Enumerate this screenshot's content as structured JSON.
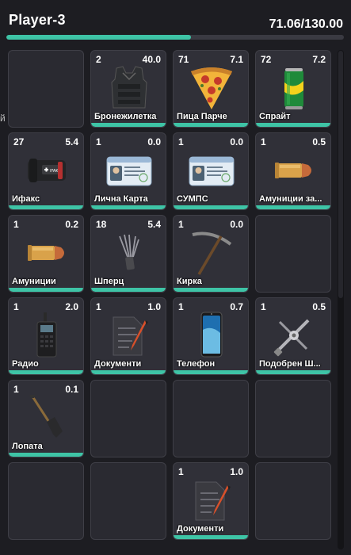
{
  "header": {
    "player_name": "Player-3",
    "weight_text": "71.06/130.00",
    "weight_fraction": 0.5466
  },
  "side_text": "й",
  "colors": {
    "accent": "#3ec4a6",
    "slot_bg": "#2a2a31",
    "slot_border": "#3f3f47",
    "page_bg": "#1d1d22"
  },
  "slots": [
    {
      "empty": true
    },
    {
      "qty": "2",
      "weight": "40.0",
      "name": "Бронежилетка",
      "icon": "armor-vest-icon"
    },
    {
      "qty": "71",
      "weight": "7.1",
      "name": "Пица Парче",
      "icon": "pizza-slice-icon"
    },
    {
      "qty": "72",
      "weight": "7.2",
      "name": "Спрайт",
      "icon": "soda-can-icon"
    },
    {
      "qty": "27",
      "weight": "5.4",
      "name": "Ифакс",
      "icon": "ifak-kit-icon"
    },
    {
      "qty": "1",
      "weight": "0.0",
      "name": "Лична Карта",
      "icon": "id-card-icon"
    },
    {
      "qty": "1",
      "weight": "0.0",
      "name": "СУМПС",
      "icon": "id-card-icon"
    },
    {
      "qty": "1",
      "weight": "0.5",
      "name": "Амуниции за...",
      "icon": "ammo-icon"
    },
    {
      "qty": "1",
      "weight": "0.2",
      "name": "Амуниции",
      "icon": "ammo-icon"
    },
    {
      "qty": "18",
      "weight": "5.4",
      "name": "Шперц",
      "icon": "lockpick-icon"
    },
    {
      "qty": "1",
      "weight": "0.0",
      "name": "Кирка",
      "icon": "pickaxe-icon"
    },
    {
      "empty": true
    },
    {
      "qty": "1",
      "weight": "2.0",
      "name": "Радио",
      "icon": "radio-icon"
    },
    {
      "qty": "1",
      "weight": "1.0",
      "name": "Документи",
      "icon": "document-icon"
    },
    {
      "qty": "1",
      "weight": "0.7",
      "name": "Телефон",
      "icon": "phone-icon"
    },
    {
      "qty": "1",
      "weight": "0.5",
      "name": "Подобрен Ш...",
      "icon": "advanced-lockpick-icon"
    },
    {
      "qty": "1",
      "weight": "0.1",
      "name": "Лопата",
      "icon": "shovel-icon"
    },
    {
      "empty": true
    },
    {
      "empty": true
    },
    {
      "empty": true
    },
    {
      "empty": true
    },
    {
      "empty": true
    },
    {
      "qty": "1",
      "weight": "1.0",
      "name": "Документи",
      "icon": "document-icon"
    },
    {
      "empty": true
    }
  ]
}
